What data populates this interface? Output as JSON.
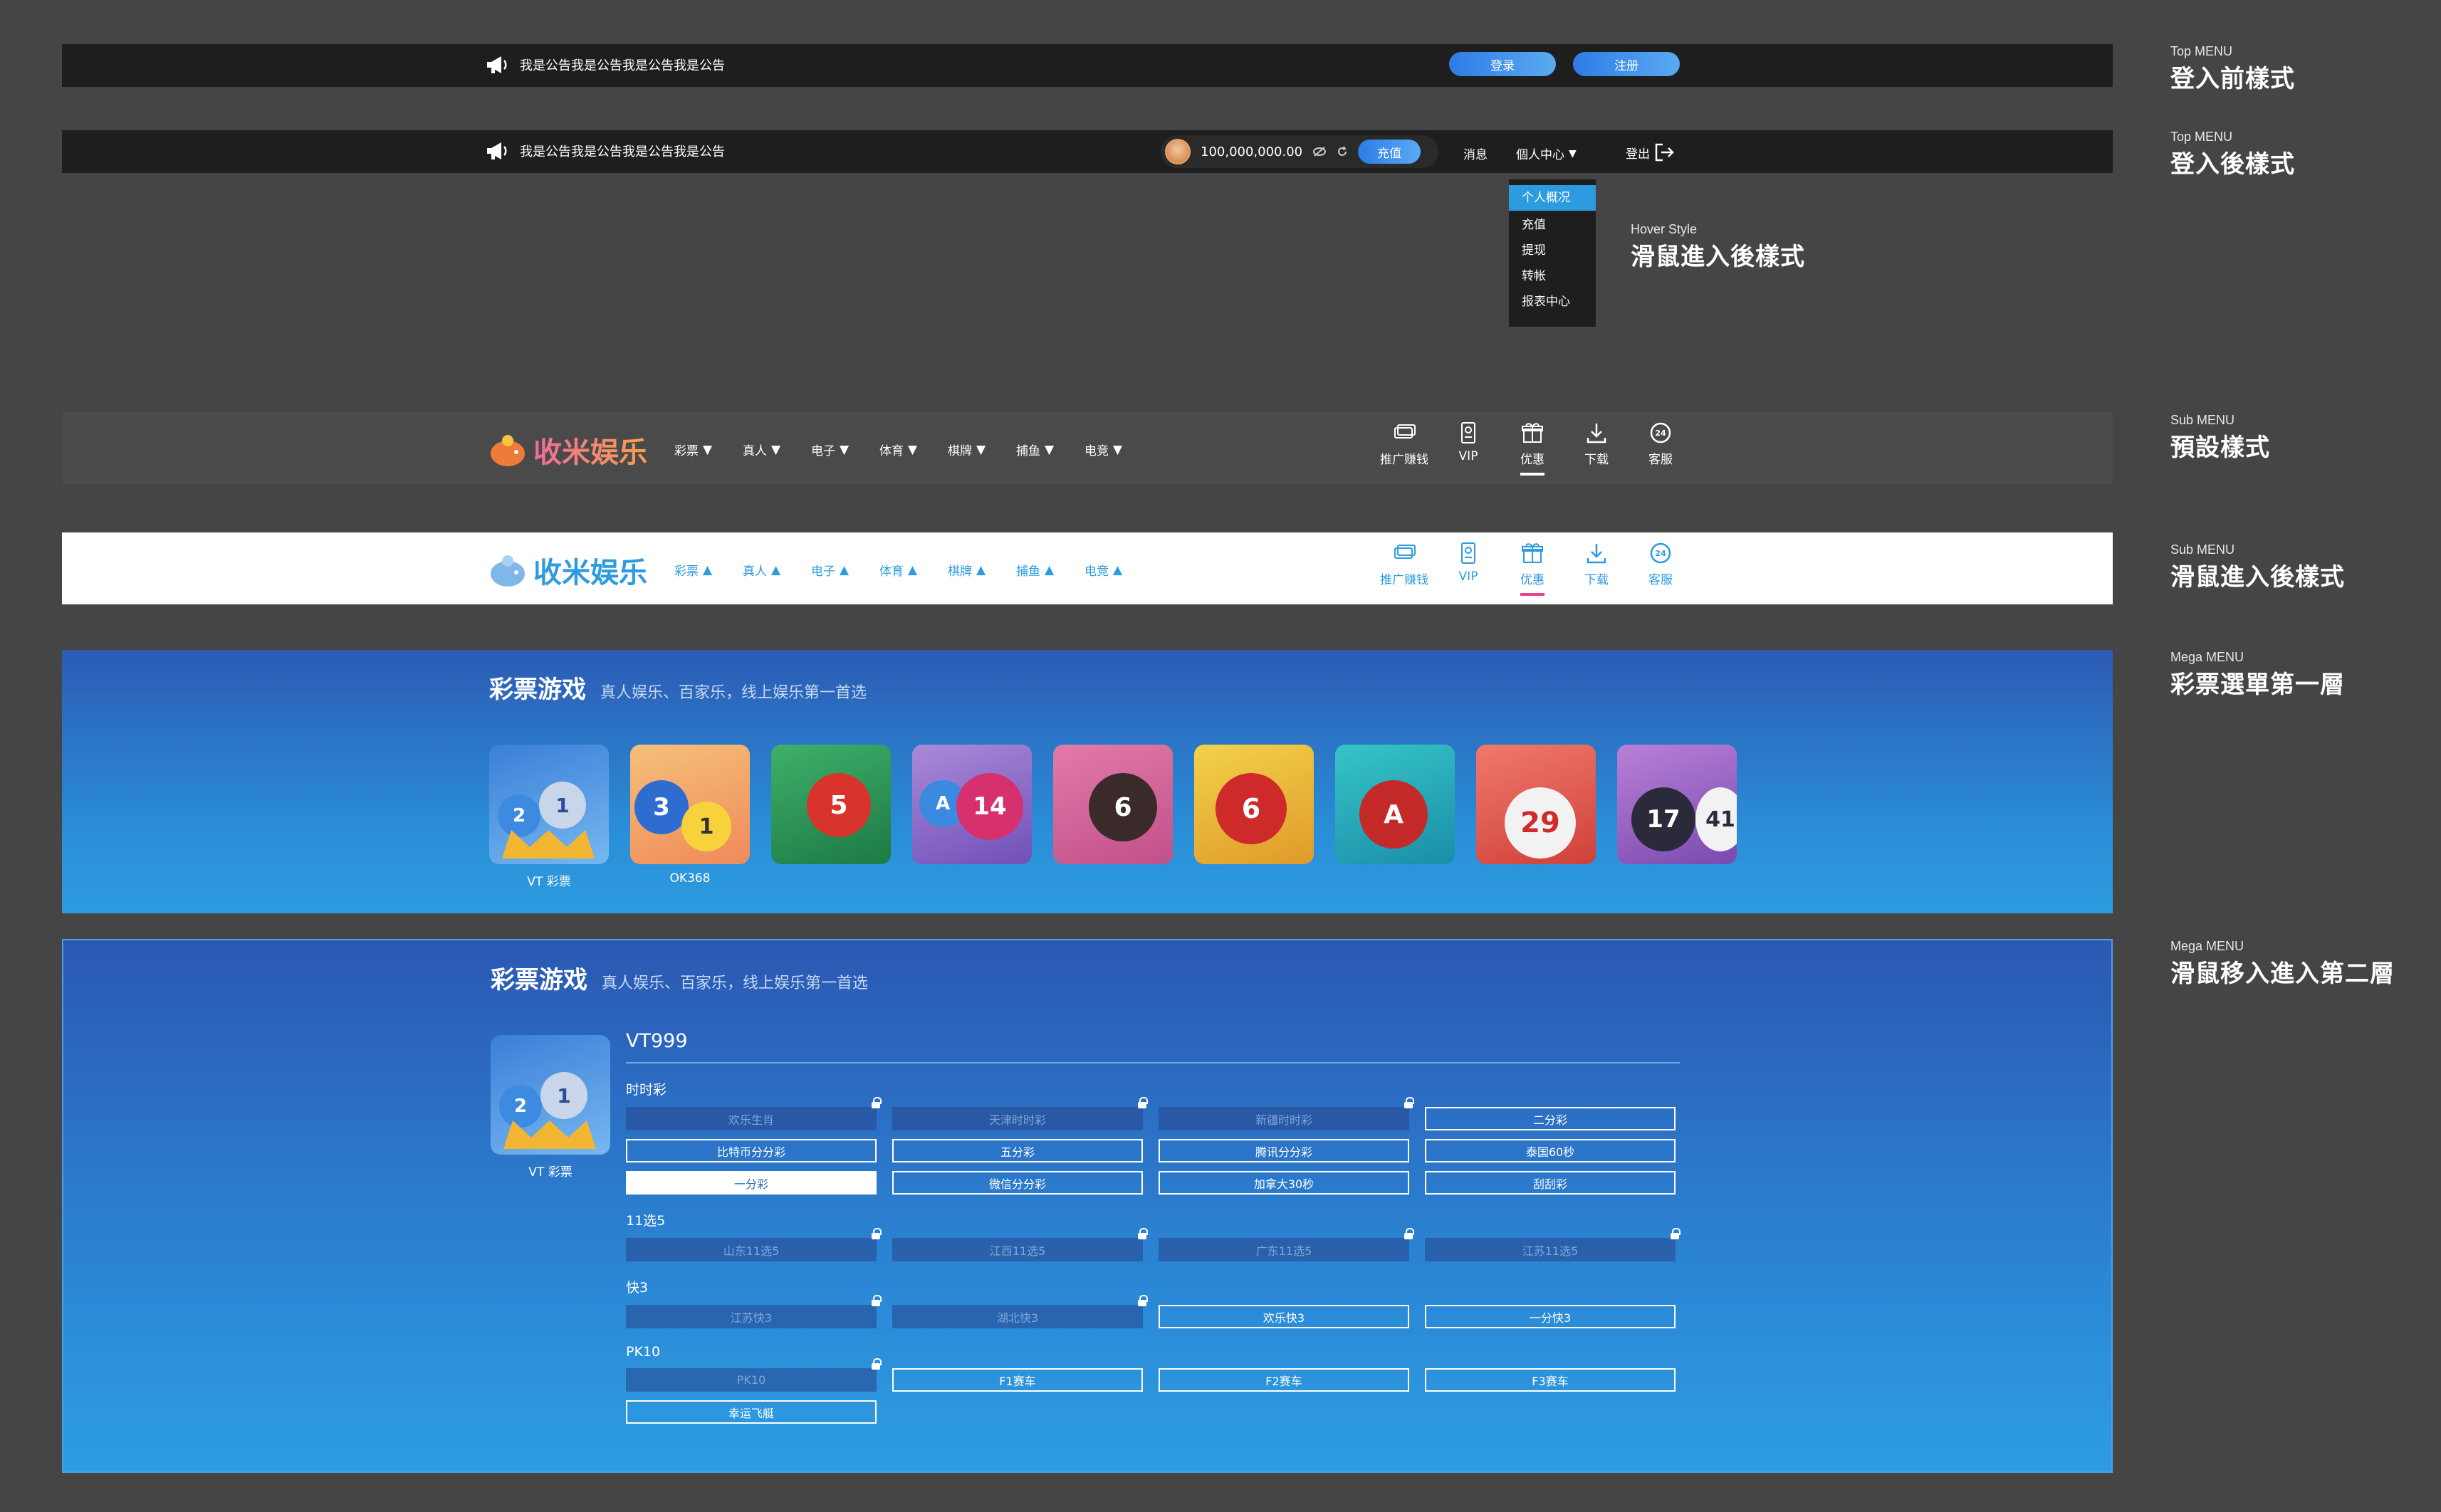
{
  "annotations": [
    {
      "en": "Top MENU",
      "zh": "登入前樣式"
    },
    {
      "en": "Top MENU",
      "zh": "登入後樣式"
    },
    {
      "en": "Hover Style",
      "zh": "滑鼠進入後樣式"
    },
    {
      "en": "Sub MENU",
      "zh": "預設樣式"
    },
    {
      "en": "Sub MENU",
      "zh": "滑鼠進入後樣式"
    },
    {
      "en": "Mega MENU",
      "zh": "彩票選單第一層"
    },
    {
      "en": "Mega MENU",
      "zh": "滑鼠移入進入第二層"
    }
  ],
  "top_before": {
    "notice": "我是公告我是公告我是公告我是公告",
    "login": "登录",
    "register": "注册"
  },
  "top_after": {
    "notice": "我是公告我是公告我是公告我是公告",
    "balance": "100,000,000.00",
    "deposit": "充值",
    "messages": "消息",
    "personal": "個人中心",
    "logout": "登出"
  },
  "dropdown": [
    "个人概况",
    "充值",
    "提现",
    "转帐",
    "报表中心"
  ],
  "logo_text": "收米娱乐",
  "sub_menu": [
    "彩票",
    "真人",
    "电子",
    "体育",
    "棋牌",
    "捕鱼",
    "电竞"
  ],
  "tools": [
    "推广赚钱",
    "VIP",
    "优惠",
    "下载",
    "客服"
  ],
  "mega": {
    "title": "彩票游戏",
    "subtitle": "真人娱乐、百家乐，线上娱乐第一首选",
    "games": [
      "VT 彩票",
      "OK368",
      "",
      "",
      "",
      "",
      "",
      "",
      ""
    ],
    "detail_game": "VT 彩票",
    "detail_title": "VT999",
    "sections": [
      {
        "name": "时时彩",
        "items": [
          {
            "label": "欢乐生肖",
            "locked": true
          },
          {
            "label": "天津时时彩",
            "locked": true
          },
          {
            "label": "新疆时时彩",
            "locked": true
          },
          {
            "label": "二分彩",
            "locked": false
          },
          {
            "label": "比特币分分彩",
            "locked": false
          },
          {
            "label": "五分彩",
            "locked": false
          },
          {
            "label": "腾讯分分彩",
            "locked": false
          },
          {
            "label": "泰国60秒",
            "locked": false
          },
          {
            "label": "一分彩",
            "locked": false,
            "selected": true
          },
          {
            "label": "微信分分彩",
            "locked": false
          },
          {
            "label": "加拿大30秒",
            "locked": false
          },
          {
            "label": "刮刮彩",
            "locked": false
          }
        ]
      },
      {
        "name": "11选5",
        "items": [
          {
            "label": "山东11选5",
            "locked": true
          },
          {
            "label": "江西11选5",
            "locked": true
          },
          {
            "label": "广东11选5",
            "locked": true
          },
          {
            "label": "江苏11选5",
            "locked": true
          }
        ]
      },
      {
        "name": "快3",
        "items": [
          {
            "label": "江苏快3",
            "locked": true
          },
          {
            "label": "湖北快3",
            "locked": true
          },
          {
            "label": "欢乐快3",
            "locked": false
          },
          {
            "label": "一分快3",
            "locked": false
          }
        ]
      },
      {
        "name": "PK10",
        "items": [
          {
            "label": "PK10",
            "locked": true
          },
          {
            "label": "F1赛车",
            "locked": false
          },
          {
            "label": "F2赛车",
            "locked": false
          },
          {
            "label": "F3赛车",
            "locked": false
          },
          {
            "label": "幸运飞艇",
            "locked": false
          }
        ]
      }
    ]
  },
  "colors": {
    "accent_blue": "#2d9be0",
    "hover_pink": "#e0458e",
    "dark_bar": "#1e1e1e",
    "sub_default_bg": "#4a4a4a",
    "sub_hover_bg": "#ffffff"
  }
}
